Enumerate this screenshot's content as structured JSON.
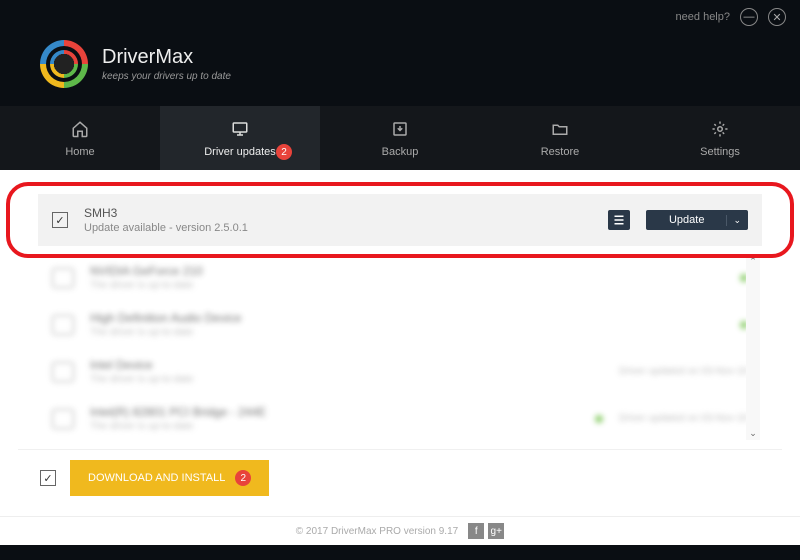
{
  "titlebar": {
    "help": "need help?"
  },
  "brand": {
    "name": "DriverMax",
    "tagline": "keeps your drivers up to date"
  },
  "tabs": {
    "home": "Home",
    "updates": "Driver updates",
    "updates_badge": "2",
    "backup": "Backup",
    "restore": "Restore",
    "settings": "Settings"
  },
  "driver": {
    "name": "SMH3",
    "status": "Update available - version 2.5.0.1",
    "update_label": "Update"
  },
  "blurred_rows": [
    {
      "title": "NVIDIA GeForce 210",
      "sub": "The driver is up-to-date",
      "dot": "g",
      "right": ""
    },
    {
      "title": "High Definition Audio Device",
      "sub": "The driver is up-to-date",
      "dot": "g",
      "right": ""
    },
    {
      "title": "Intel Device",
      "sub": "The driver is up-to-date",
      "dot": "",
      "right": "Driver updated on 03-Nov-16"
    },
    {
      "title": "Intel(R) 82801 PCI Bridge - 244E",
      "sub": "The driver is up-to-date",
      "dot": "g",
      "right": "Driver updated on 03-Nov-16"
    }
  ],
  "download": {
    "label": "DOWNLOAD AND INSTALL",
    "badge": "2"
  },
  "footer": {
    "copyright": "© 2017 DriverMax PRO version 9.17"
  }
}
